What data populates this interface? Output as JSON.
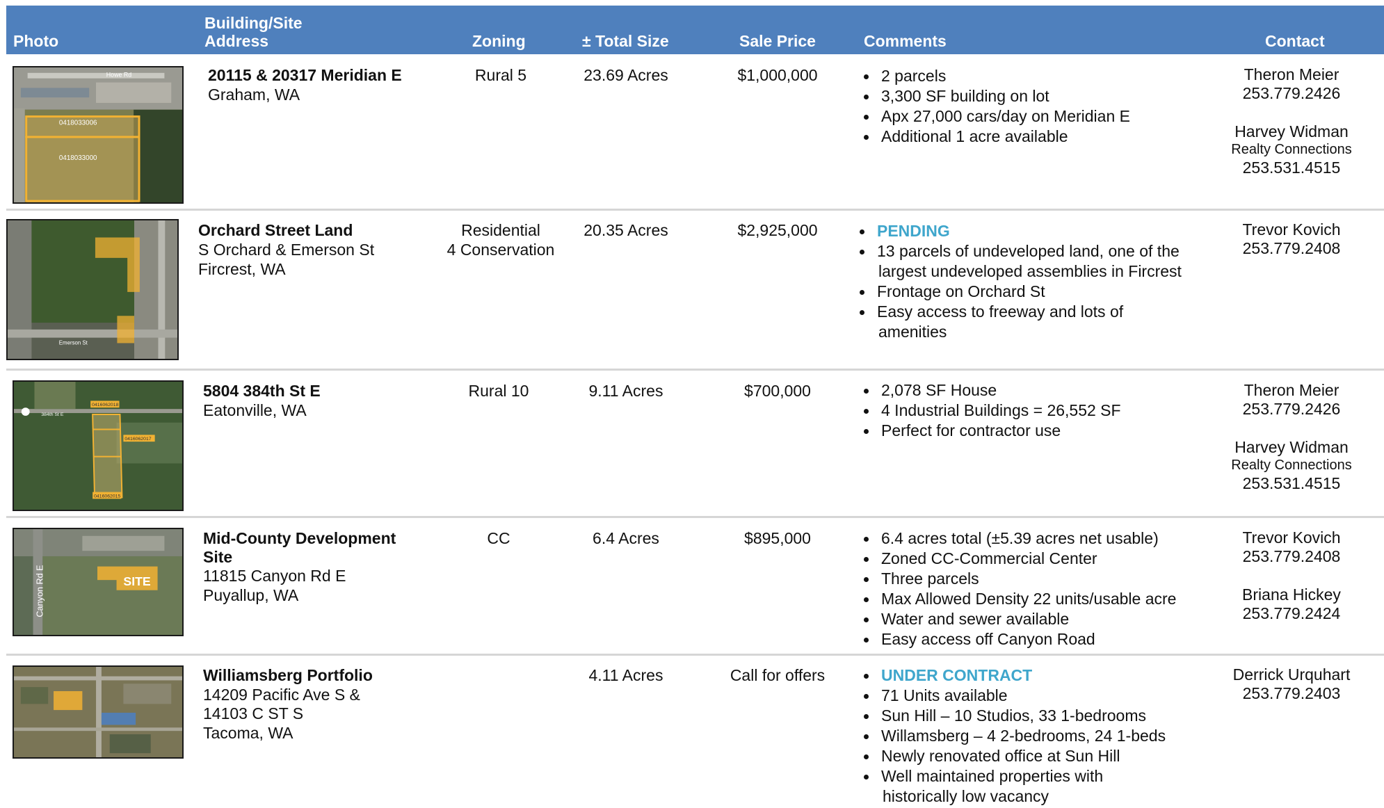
{
  "header": {
    "photo": "Photo",
    "address_l1": "Building/Site",
    "address_l2": "Address",
    "zoning": "Zoning",
    "size": "± Total Size",
    "price": "Sale Price",
    "comments": "Comments",
    "contact": "Contact"
  },
  "rows": [
    {
      "name": "20115 & 20317 Meridian E",
      "addr1": "Graham, WA",
      "zoning1": "Rural 5",
      "size": "23.69 Acres",
      "price": "$1,000,000",
      "comments": [
        "2 parcels",
        "3,300 SF building on lot",
        "Apx 27,000 cars/day on Meridian E",
        "Additional 1 acre available"
      ],
      "contact1": {
        "name": "Theron Meier",
        "phone": "253.779.2426"
      },
      "contact2": {
        "name": "Harvey Widman",
        "org": "Realty Connections",
        "phone": "253.531.4515"
      },
      "photo_labels": [
        "Howe Rd",
        "0418033006",
        "0418033000"
      ]
    },
    {
      "name": "Orchard Street Land",
      "addr1": "S Orchard & Emerson St",
      "addr2": "Fircrest, WA",
      "zoning1": "Residential",
      "zoning2": "4 Conservation",
      "size": "20.35 Acres",
      "price": "$2,925,000",
      "status": "PENDING",
      "comments": [
        "13 parcels of undeveloped land, one of the",
        "largest undeveloped assemblies in Fircrest",
        "Frontage on Orchard St",
        "Easy access to freeway and lots of",
        "amenities"
      ],
      "contact1": {
        "name": "Trevor Kovich",
        "phone": "253.779.2408"
      },
      "photo_labels": [
        "Emerson St"
      ]
    },
    {
      "name": "5804 384th St E",
      "addr1": "Eatonville, WA",
      "zoning1": "Rural 10",
      "size": "9.11 Acres",
      "price": "$700,000",
      "comments": [
        "2,078 SF House",
        "4 Industrial Buildings = 26,552 SF",
        "Perfect for contractor use"
      ],
      "contact1": {
        "name": "Theron Meier",
        "phone": "253.779.2426"
      },
      "contact2": {
        "name": "Harvey Widman",
        "org": "Realty Connections",
        "phone": "253.531.4515"
      },
      "photo_labels": [
        "0416062018",
        "384th St E",
        "0416062017",
        "0416062015"
      ]
    },
    {
      "name1": "Mid-County Development",
      "name2": "Site",
      "addr1": "11815 Canyon Rd E",
      "addr2": "Puyallup, WA",
      "zoning1": "CC",
      "size": "6.4 Acres",
      "price": "$895,000",
      "comments": [
        "6.4 acres total (±5.39 acres net usable)",
        "Zoned CC-Commercial Center",
        "Three parcels",
        "Max Allowed Density 22 units/usable acre",
        "Water and sewer available",
        "Easy access off Canyon Road"
      ],
      "contact1": {
        "name": "Trevor Kovich",
        "phone": "253.779.2408"
      },
      "contact2": {
        "name": "Briana Hickey",
        "phone": "253.779.2424"
      },
      "photo_labels": [
        "Canyon Rd E",
        "SITE"
      ]
    },
    {
      "name": "Williamsberg Portfolio",
      "addr1": "14209 Pacific Ave S &",
      "addr2": "14103 C ST S",
      "addr3": "Tacoma, WA",
      "size": "4.11 Acres",
      "price": "Call for offers",
      "status": "UNDER CONTRACT",
      "comments": [
        "71 Units available",
        "Sun Hill – 10 Studios, 33 1-bedrooms",
        "Willamsberg – 4 2-bedrooms, 24 1-beds",
        "Newly renovated office at Sun Hill",
        "Well maintained properties with",
        "historically low vacancy"
      ],
      "contact1": {
        "name": "Derrick Urquhart",
        "phone": "253.779.2403"
      }
    }
  ],
  "colors": {
    "header_bg": "#4f80bd",
    "status": "#3fa6cc",
    "parcel": "#f2b233",
    "separator": "#d6d6d6"
  }
}
